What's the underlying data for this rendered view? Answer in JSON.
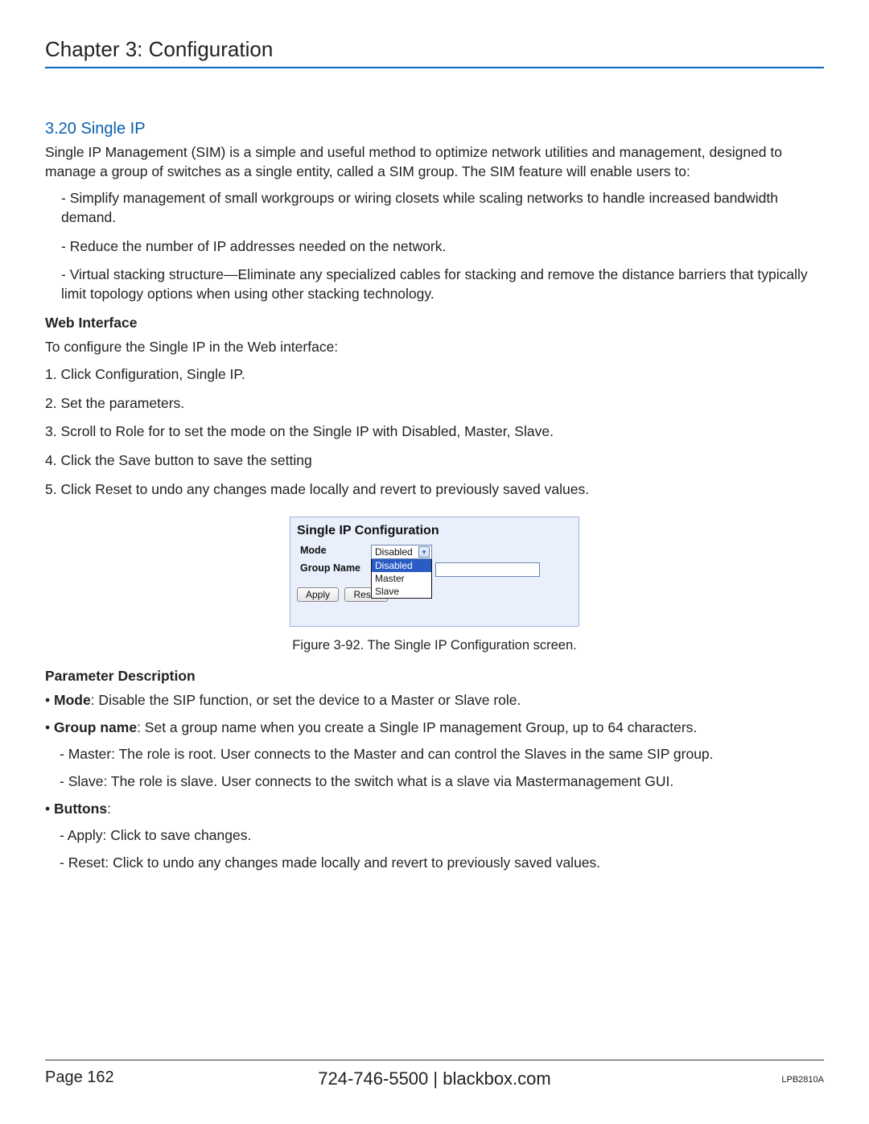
{
  "chapter": "Chapter 3: Configuration",
  "section_title": "3.20 Single IP",
  "intro": "Single IP Management (SIM) is a simple and useful method to optimize network utilities and management, designed to manage a group of switches as a single entity, called a SIM group. The SIM feature will enable users to:",
  "features": [
    "- Simplify management of small workgroups or wiring closets while scaling networks to handle increased bandwidth demand.",
    "- Reduce the number of IP addresses needed on the network.",
    "- Virtual stacking structure—Eliminate any specialized cables for stacking and remove the distance barriers that typically limit topology options when using other stacking technology."
  ],
  "web_interface_head": "Web Interface",
  "web_interface_lead": "To configure the Single IP in the Web interface:",
  "steps": [
    "1. Click Configuration, Single IP.",
    "2. Set the parameters.",
    "3. Scroll to Role for to set the mode on the Single IP with Disabled, Master, Slave.",
    "4. Click the Save button to save the setting",
    "5. Click Reset to undo any changes made locally and revert to previously saved values."
  ],
  "figure": {
    "title": "Single IP Configuration",
    "mode_label": "Mode",
    "group_label": "Group Name",
    "selected": "Disabled",
    "options": [
      "Disabled",
      "Master",
      "Slave"
    ],
    "group_value": "",
    "apply": "Apply",
    "reset": "Reset",
    "caption": "Figure 3-92. The Single IP Configuration screen."
  },
  "param_head": "Parameter Description",
  "params": {
    "mode_label": "Mode",
    "mode_text": ": Disable the SIP function, or set the device to a Master or Slave role.",
    "group_label": "Group name",
    "group_text": ": Set a group name when you create a Single IP management Group, up to 64 characters.",
    "master": "- Master: The role is root. User connects to the Master and can control the Slaves in the same SIP group.",
    "slave": "- Slave: The role is slave. User connects to the switch what is a slave via Mastermanagement GUI.",
    "buttons_label": "Buttons",
    "buttons_colon": ":",
    "apply": "- Apply: Click to save changes.",
    "reset": "- Reset: Click to undo any changes made locally and revert to previously saved values."
  },
  "footer": {
    "page": "Page 162",
    "center": "724-746-5500   |   blackbox.com",
    "model": "LPB2810A"
  }
}
